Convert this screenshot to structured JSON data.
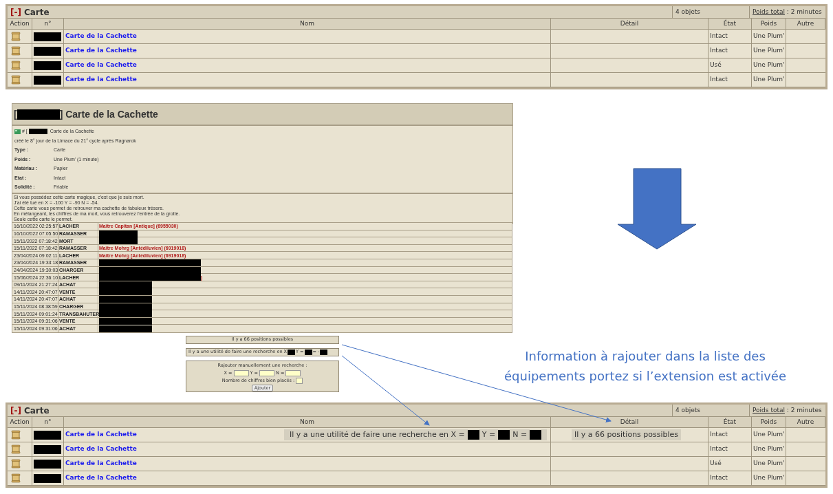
{
  "top_panel": {
    "toggle": "[-]",
    "title": "Carte",
    "count": "4 objets",
    "weight_label": "Poids total",
    "weight_value": " : 2 minutes",
    "columns": [
      "Action",
      "n°",
      "Nom",
      "Détail",
      "État",
      "Poids",
      "Autre"
    ],
    "rows": [
      {
        "name": "Carte de la Cachette",
        "state": "Intact",
        "weight": "Une Plum'"
      },
      {
        "name": "Carte de la Cachette",
        "state": "Intact",
        "weight": "Une Plum'"
      },
      {
        "name": "Carte de la Cachette",
        "state": "Usé",
        "weight": "Une Plum'"
      },
      {
        "name": "Carte de la Cachette",
        "state": "Intact",
        "weight": "Une Plum'"
      }
    ]
  },
  "detail": {
    "title_open": "[",
    "title_close": "] Carte de la Cachette",
    "ref_prefix": "# [",
    "ref_name": "Carte de la Cachette",
    "created": "créé le 8° jour de la Limace du 21° cycle après Ragnarok",
    "props": [
      {
        "label": "Type :",
        "value": "Carte"
      },
      {
        "label": "Poids :",
        "value": "Une Plum' (1 minute)"
      },
      {
        "label": "Matériau :",
        "value": "Papier"
      },
      {
        "label": "Etat :",
        "value": "Intact"
      },
      {
        "label": "Solidité :",
        "value": "Friable"
      }
    ],
    "description": [
      "Si vous possédez cette carte magique, c'est que je suis mort.",
      "J'ai été tué en X = -100 Y = -90 N = -54.",
      "Cette carte vous permet de retrouver ma cachette de fabuleux trésors.",
      "En mélangeant, les chiffres de ma mort, vous retrouverez l'entrée de la grotte.",
      "Seule cette carte le permet."
    ]
  },
  "history": [
    {
      "date": "16/10/2022 02:25:57",
      "action": "LACHER",
      "kind": "named",
      "actor": "Maître Capitan [Antique] (6955030)"
    },
    {
      "date": "16/10/2022 07:05:50",
      "action": "RAMASSER",
      "kind": "short"
    },
    {
      "date": "15/11/2022 07:18:42",
      "action": "MORT",
      "kind": "short"
    },
    {
      "date": "15/11/2022 07:18:42",
      "action": "RAMASSER",
      "kind": "named",
      "actor": "Maître Mohrg [Antédiluvien] (6919018)"
    },
    {
      "date": "23/04/2024 09:02:11",
      "action": "LACHER",
      "kind": "named",
      "actor": "Maître Mohrg [Antédiluvien] (6919018)"
    },
    {
      "date": "23/04/2024 19:33:18",
      "action": "RAMASSER",
      "kind": "wide"
    },
    {
      "date": "24/04/2024 19:30:03",
      "action": "CHARGER",
      "kind": "wide"
    },
    {
      "date": "15/06/2024 22:36:10",
      "action": "LACHER",
      "kind": "wide",
      "tail": ")"
    },
    {
      "date": "09/11/2024 21:27:24",
      "action": "ACHAT",
      "kind": "narrow"
    },
    {
      "date": "14/11/2024 20:47:07",
      "action": "VENTE",
      "kind": "narrow"
    },
    {
      "date": "14/11/2024 20:47:07",
      "action": "ACHAT",
      "kind": "narrow"
    },
    {
      "date": "15/11/2024 08:38:59",
      "action": "CHARGER",
      "kind": "narrow"
    },
    {
      "date": "15/11/2024 09:01:24",
      "action": "TRANSBAHUTER",
      "kind": "narrow"
    },
    {
      "date": "15/11/2024 09:31:06",
      "action": "VENTE",
      "kind": "narrow"
    },
    {
      "date": "15/11/2024 09:31:06",
      "action": "ACHAT",
      "kind": "narrow"
    }
  ],
  "positions_box": "Il y a 66 positions possibles",
  "search_hint": [
    "Il y a une utilité de faire une recherche en X",
    "Y =",
    "= -"
  ],
  "manual_search": {
    "title": "Rajouter manuellement une recherche :",
    "x_label": "X =",
    "y_label": "Y =",
    "n_label": "N =",
    "count_label": "Nombre de chiffres bien placés :",
    "button": "Ajouter"
  },
  "callout": [
    "Information à rajouter dans la liste des",
    "équipements portez si l’extension est activée"
  ],
  "bottom_panel": {
    "toggle": "[-]",
    "title": "Carte",
    "count": "4 objets",
    "weight_label": "Poids total",
    "weight_value": " : 2 minutes",
    "columns": [
      "Action",
      "n°",
      "Nom",
      "Détail",
      "État",
      "Poids",
      "Autre"
    ],
    "rows": [
      {
        "name": "Carte de la Cachette",
        "state": "Intact",
        "weight": "Une Plum'",
        "hint": [
          "Il y a une utilité de faire une recherche en X =",
          "Y =",
          "N ="
        ],
        "detail": "Il y a 66 positions possibles"
      },
      {
        "name": "Carte de la Cachette",
        "state": "Intact",
        "weight": "Une Plum'"
      },
      {
        "name": "Carte de la Cachette",
        "state": "Usé",
        "weight": "Une Plum'"
      },
      {
        "name": "Carte de la Cachette",
        "state": "Intact",
        "weight": "Une Plum'"
      }
    ]
  }
}
